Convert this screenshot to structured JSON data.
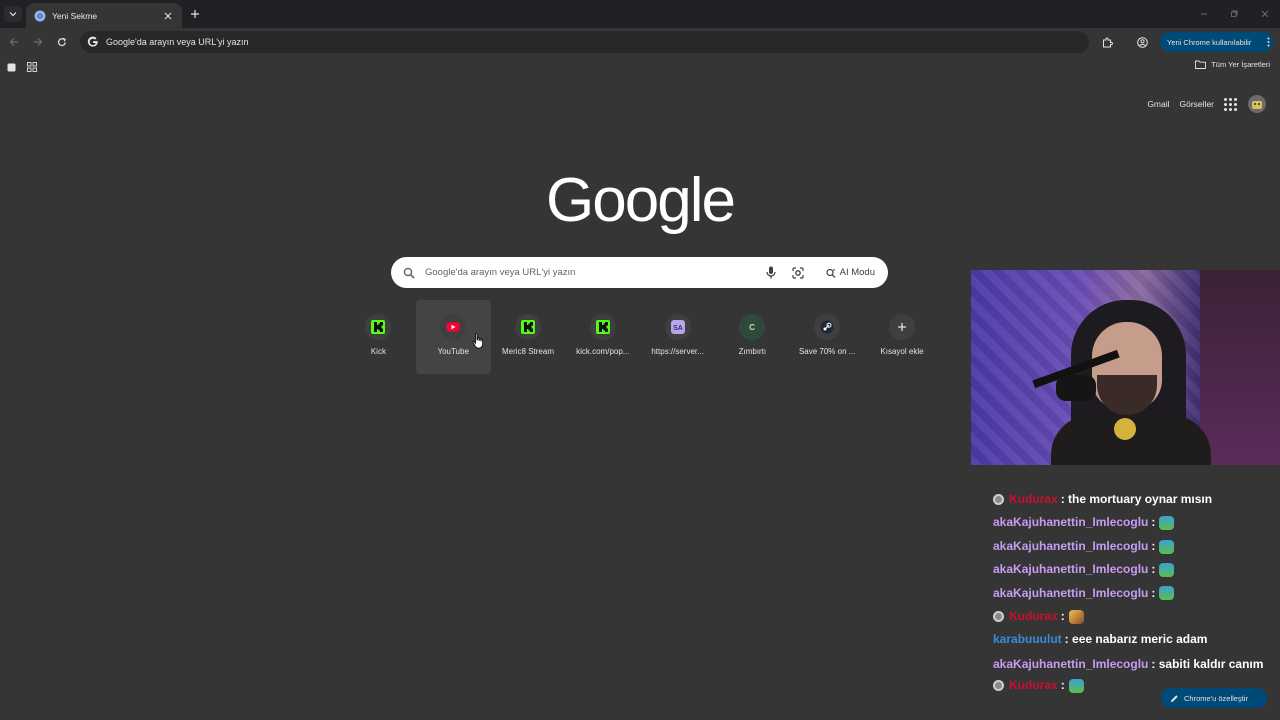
{
  "tab": {
    "title": "Yeni Sekme"
  },
  "omnibox": {
    "text": "Google'da arayın veya URL'yi yazın"
  },
  "toolbar": {
    "profile_label": "Yeni Chrome kullanılabilir"
  },
  "bookmarks": {
    "all_label": "Tüm Yer İşaretleri"
  },
  "ntp": {
    "links": [
      "Gmail",
      "Görseller"
    ],
    "logo": "Google",
    "search_placeholder": "Google'da arayın veya URL'yi yazın",
    "ai_mode_label": "AI Modu",
    "shortcuts": [
      {
        "label": "Kick",
        "icon": "kick-icon"
      },
      {
        "label": "YouTube",
        "icon": "youtube-icon"
      },
      {
        "label": "Meric8 Stream",
        "icon": "kick-icon"
      },
      {
        "label": "kick.com/pop...",
        "icon": "kick-icon"
      },
      {
        "label": "https://server...",
        "icon": "server-icon"
      },
      {
        "label": "Zımbırtı",
        "icon": "letter-c-icon"
      },
      {
        "label": "Save 70% on ...",
        "icon": "steam-icon"
      },
      {
        "label": "Kısayol ekle",
        "icon": "plus-icon"
      }
    ],
    "customize_label": "Chrome'u özelleştir"
  },
  "chat": {
    "messages": [
      {
        "user": "Kudurax",
        "user_color": "#c8102e",
        "badge": true,
        "text": "the mortuary oynar mısın",
        "emote": false
      },
      {
        "user": "akaKajuhanettin_Imlecoglu",
        "user_color": "#c79cf2",
        "badge": false,
        "text": "",
        "emote": true
      },
      {
        "user": "akaKajuhanettin_Imlecoglu",
        "user_color": "#c79cf2",
        "badge": false,
        "text": "",
        "emote": true
      },
      {
        "user": "akaKajuhanettin_Imlecoglu",
        "user_color": "#c79cf2",
        "badge": false,
        "text": "",
        "emote": true
      },
      {
        "user": "akaKajuhanettin_Imlecoglu",
        "user_color": "#c79cf2",
        "badge": false,
        "text": "",
        "emote": true
      },
      {
        "user": "Kudurax",
        "user_color": "#c8102e",
        "badge": true,
        "text": "",
        "emote": true
      },
      {
        "user": "karabuuulut",
        "user_color": "#3a8bd8",
        "badge": false,
        "text": "eee nabarız meric adam",
        "emote": false
      },
      {
        "user": "akaKajuhanettin_Imlecoglu",
        "user_color": "#c79cf2",
        "badge": false,
        "text": "sabiti kaldır canım",
        "emote": false
      },
      {
        "user": "Kudurax",
        "user_color": "#c8102e",
        "badge": true,
        "text": "",
        "emote": true
      }
    ]
  }
}
